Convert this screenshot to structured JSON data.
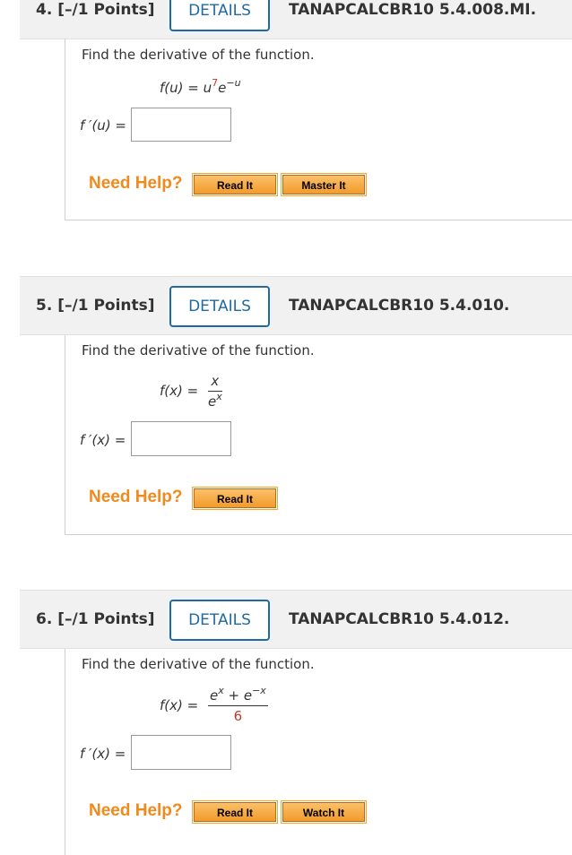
{
  "questions": [
    {
      "number": "4.",
      "points": "[–/1 Points]",
      "details_label": "DETAILS",
      "code": "TANAPCALCBR10 5.4.008.MI.",
      "prompt": "Find the derivative of the function.",
      "function": {
        "lhs": "f(u) = ",
        "base": "u",
        "exp_red": "7",
        "base2": "e",
        "exp2": "−u"
      },
      "answer_label": "f ′(u) =",
      "answer_value": "",
      "need_help": "Need Help?",
      "help_buttons": [
        "Read It",
        "Master It"
      ]
    },
    {
      "number": "5.",
      "points": "[–/1 Points]",
      "details_label": "DETAILS",
      "code": "TANAPCALCBR10 5.4.010.",
      "prompt": "Find the derivative of the function.",
      "function": {
        "lhs": "f(x) = ",
        "numerator": "x",
        "den_base": "e",
        "den_exp": "x"
      },
      "answer_label": "f ′(x) =",
      "answer_value": "",
      "need_help": "Need Help?",
      "help_buttons": [
        "Read It"
      ]
    },
    {
      "number": "6.",
      "points": "[–/1 Points]",
      "details_label": "DETAILS",
      "code": "TANAPCALCBR10 5.4.012.",
      "prompt": "Find the derivative of the function.",
      "function": {
        "lhs": "f(x) = ",
        "num_a": "e",
        "num_a_exp": "x",
        "num_op": " + ",
        "num_b": "e",
        "num_b_exp": "−x",
        "denominator_red": "6"
      },
      "answer_label": "f ′(x) =",
      "answer_value": "",
      "need_help": "Need Help?",
      "help_buttons": [
        "Read It",
        "Watch It"
      ]
    }
  ],
  "colors": {
    "accent": "#1f6aa0",
    "help": "#f08a1c",
    "highlight_red": "#c0392b"
  }
}
